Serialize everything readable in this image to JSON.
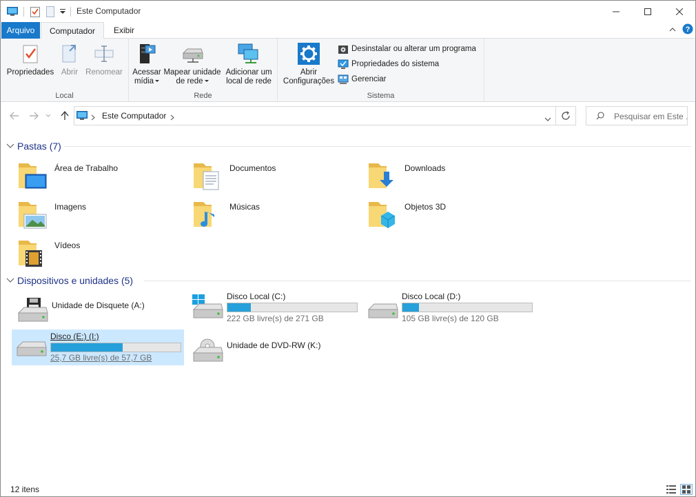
{
  "window": {
    "title": "Este Computador"
  },
  "ribbon_tabs": {
    "file": "Arquivo",
    "computer": "Computador",
    "view": "Exibir"
  },
  "ribbon": {
    "local": {
      "label": "Local",
      "properties": "Propriedades",
      "open": "Abrir",
      "rename": "Renomear"
    },
    "network": {
      "label": "Rede",
      "access_media_1": "Acessar",
      "access_media_2": "mídia",
      "map_drive_1": "Mapear unidade",
      "map_drive_2": "de rede",
      "add_location_1": "Adicionar um",
      "add_location_2": "local de rede"
    },
    "system": {
      "label": "Sistema",
      "open_settings_1": "Abrir",
      "open_settings_2": "Configurações",
      "uninstall": "Desinstalar ou alterar um programa",
      "system_properties": "Propriedades do sistema",
      "manage": "Gerenciar"
    }
  },
  "address": {
    "path": "Este Computador",
    "search_placeholder": "Pesquisar em Este ..."
  },
  "folders_section": {
    "title": "Pastas (7)",
    "items": [
      {
        "label": "Área de Trabalho",
        "icon": "desktop-folder-icon"
      },
      {
        "label": "Documentos",
        "icon": "documents-folder-icon"
      },
      {
        "label": "Downloads",
        "icon": "downloads-folder-icon"
      },
      {
        "label": "Imagens",
        "icon": "pictures-folder-icon"
      },
      {
        "label": "Músicas",
        "icon": "music-folder-icon"
      },
      {
        "label": "Objetos 3D",
        "icon": "3d-objects-folder-icon"
      },
      {
        "label": "Vídeos",
        "icon": "videos-folder-icon"
      }
    ]
  },
  "devices_section": {
    "title": "Dispositivos e unidades (5)",
    "items": [
      {
        "name": "Unidade de Disquete (A:)",
        "free": "",
        "usage": null,
        "icon": "floppy-drive-icon"
      },
      {
        "name": "Disco Local (C:)",
        "free": "222 GB livre(s) de 271 GB",
        "usage": 0.18,
        "icon": "windows-drive-icon"
      },
      {
        "name": "Disco Local (D:)",
        "free": "105 GB livre(s) de 120 GB",
        "usage": 0.125,
        "icon": "hard-drive-icon"
      },
      {
        "name": "Disco (E:) (I:)",
        "free": "25,7 GB livre(s) de 57,7 GB",
        "usage": 0.555,
        "icon": "hard-drive-icon",
        "selected": true
      },
      {
        "name": "Unidade de DVD-RW (K:)",
        "free": "",
        "usage": null,
        "icon": "dvd-drive-icon"
      }
    ]
  },
  "status": {
    "count": "12 itens"
  },
  "colors": {
    "accent": "#1979ca",
    "bar_fill": "#26a0da",
    "selection": "#cce8ff",
    "section_header": "#1e3287"
  }
}
